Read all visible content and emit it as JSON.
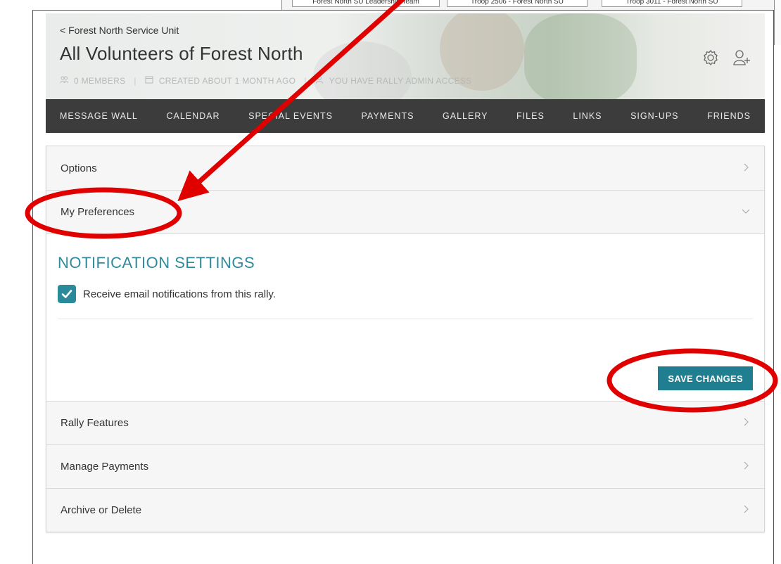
{
  "background_tabs": [
    "Forest North SU Leadership Team",
    "Troop 2506 - Forest North SU",
    "Troop 3011 - Forest North SU"
  ],
  "hero": {
    "breadcrumb": "< Forest North Service Unit",
    "title": "All Volunteers of Forest North",
    "members": "0 MEMBERS",
    "created": "CREATED ABOUT 1 MONTH AGO",
    "access": "YOU HAVE RALLY ADMIN ACCESS"
  },
  "nav": {
    "items": [
      "MESSAGE WALL",
      "CALENDAR",
      "SPECIAL EVENTS",
      "PAYMENTS",
      "GALLERY",
      "FILES",
      "LINKS",
      "SIGN-UPS",
      "FRIENDS"
    ]
  },
  "accordion": {
    "options": "Options",
    "my_preferences": "My Preferences",
    "rally_features": "Rally Features",
    "manage_payments": "Manage Payments",
    "archive_delete": "Archive or Delete"
  },
  "preferences": {
    "section_title": "NOTIFICATION SETTINGS",
    "email_checkbox_label": "Receive email notifications from this rally.",
    "email_checked": true,
    "save_label": "SAVE CHANGES"
  },
  "colors": {
    "accent": "#2f8a9c",
    "button": "#1f7f90",
    "nav_bg": "#3c3c3c",
    "annotation": "#e00000"
  },
  "icons": [
    "settings-gear-icon",
    "add-member-icon",
    "members-icon",
    "calendar-icon",
    "user-icon",
    "chevron-right-icon",
    "chevron-down-icon",
    "checkmark-icon"
  ]
}
